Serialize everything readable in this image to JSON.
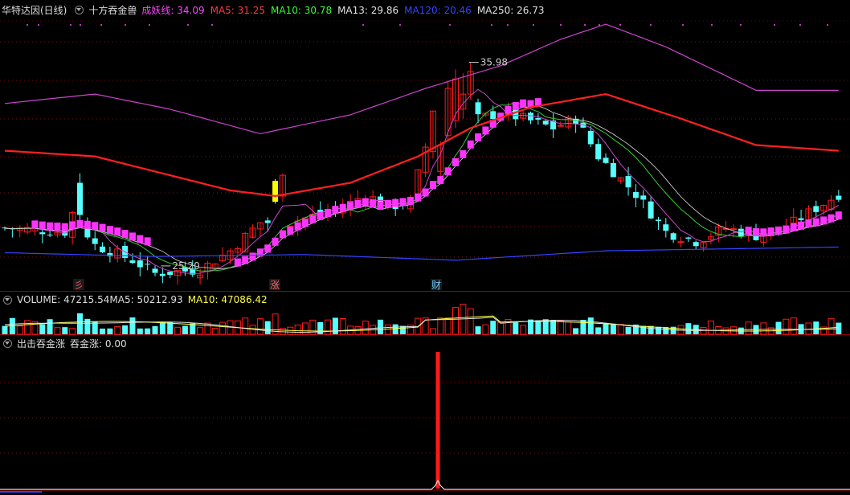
{
  "chart_data": {
    "type": "candlestick",
    "main": {
      "stock": "华特达因(日线)",
      "indicator": "十方吞金兽",
      "ma_values": [
        {
          "name": "成妖线",
          "value": "34.09",
          "color": "#ff44ff"
        },
        {
          "name": "MA5",
          "value": "31.25",
          "color": "#ff3b3b"
        },
        {
          "name": "MA10",
          "value": "30.78",
          "color": "#33ff33"
        },
        {
          "name": "MA13",
          "value": "29.86",
          "color": "#e0e0e0"
        },
        {
          "name": "MA120",
          "value": "20.46",
          "color": "#3344ff"
        },
        {
          "name": "MA250",
          "value": "26.73",
          "color": "#e0e0e0"
        }
      ],
      "high_label": "35.98",
      "low_label": "25.20",
      "markers": [
        "彡",
        "涨",
        "财"
      ],
      "colors": {
        "up": "#ff1a1a",
        "down": "#55ffff",
        "yellow": "#ffff00",
        "magenta": "#ff33ff",
        "ma250": "#ff2020",
        "ma120": "#3344ff",
        "upper_band": "#cc44cc",
        "ma5": "#cc44cc",
        "ma10": "#33cc33",
        "ma13": "#dddddd"
      }
    },
    "volume": {
      "label": "VOLUME",
      "value": "47215.54",
      "ma5_label": "MA5",
      "ma5_value": "50212.93",
      "ma10_label": "MA10",
      "ma10_value": "47086.42"
    },
    "signal": {
      "name": "出击吞金涨",
      "sub_name": "吞金涨",
      "sub_value": "0.00"
    }
  }
}
